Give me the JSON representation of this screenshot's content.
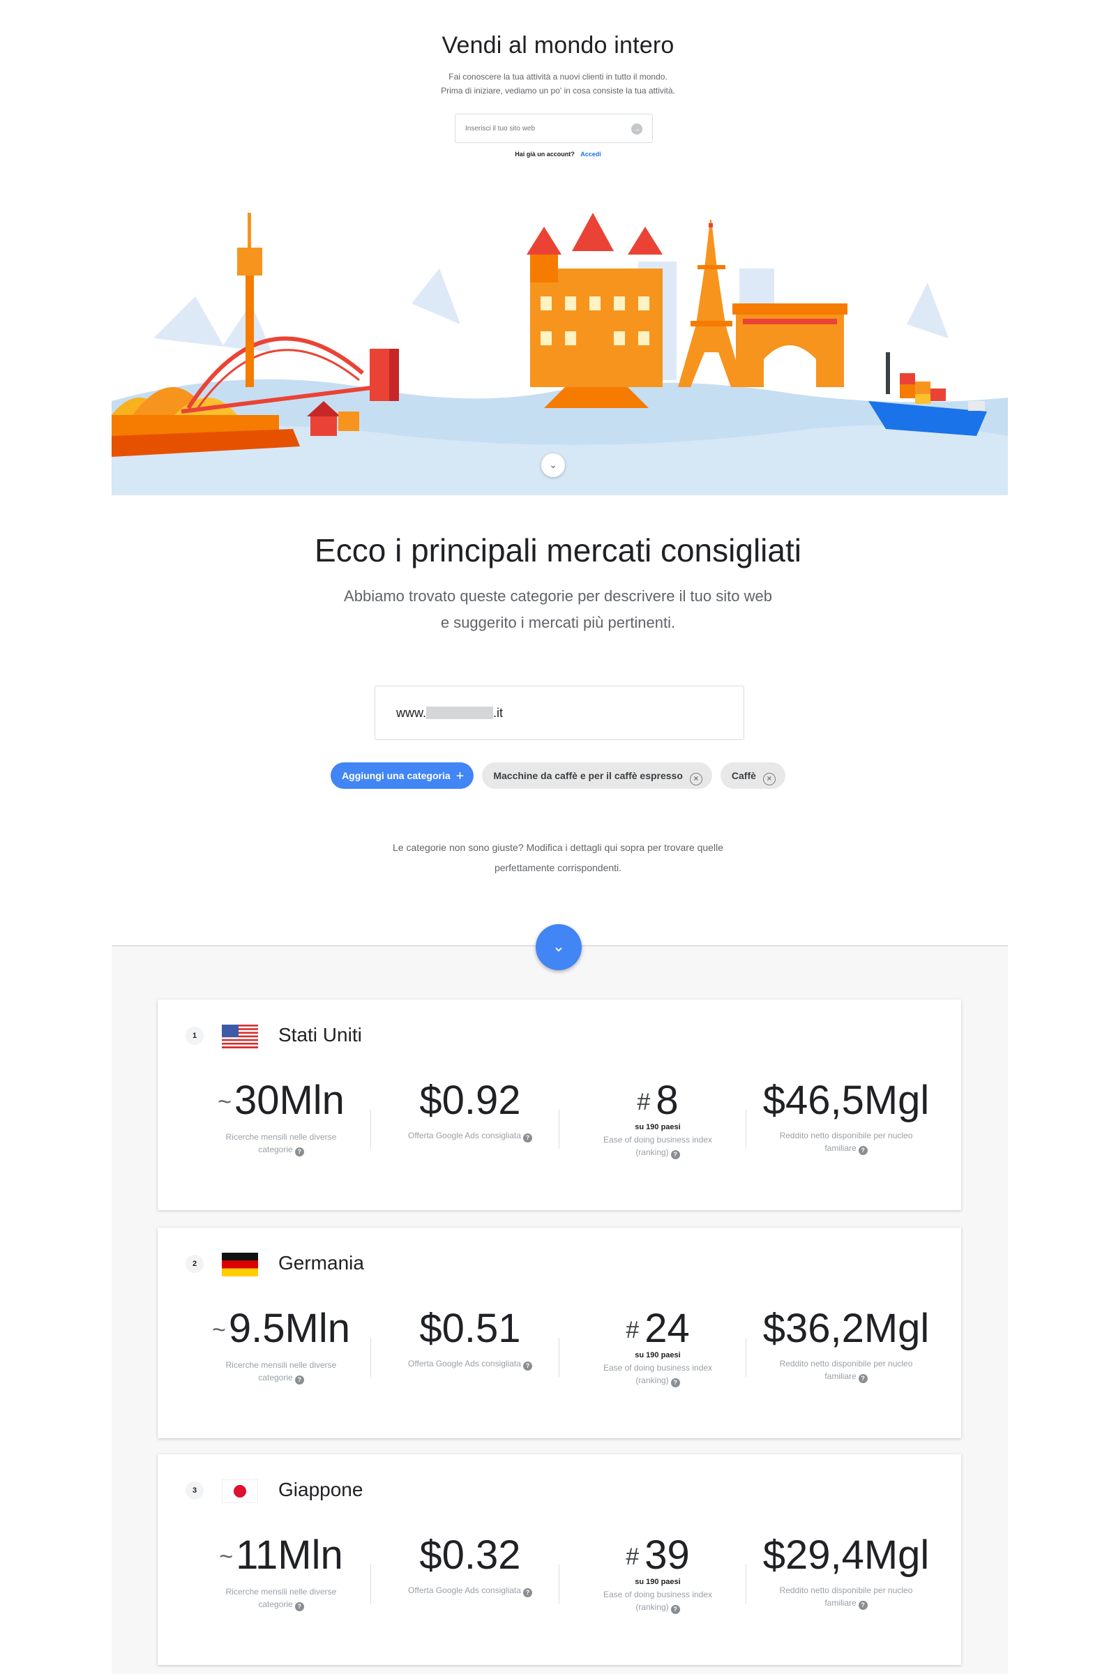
{
  "hero": {
    "title": "Vendi al mondo intero",
    "subtitle_1": "Fai conoscere la tua attività a nuovi clienti in tutto il mondo.",
    "subtitle_2": "Prima di iniziare, vediamo un po' in cosa consiste la tua attività.",
    "input_placeholder": "Inserisci il tuo sito web",
    "account_text": "Hai già un account?",
    "login_link": "Accedi"
  },
  "markets": {
    "title": "Ecco i principali mercati consigliati",
    "subtitle_1": "Abbiamo trovato queste categorie per descrivere il tuo sito web",
    "subtitle_2": "e suggerito i mercati più pertinenti.",
    "site_prefix": "www.",
    "site_suffix": ".it",
    "add_category_label": "Aggiungi una categoria",
    "categories": [
      "Macchine da caffè e per il caffè espresso",
      "Caffè"
    ],
    "hint_1": "Le categorie non sono giuste? Modifica i dettagli qui sopra per trovare quelle",
    "hint_2": "perfettamente corrispondenti."
  },
  "labels": {
    "searches_1": "Ricerche mensili nelle diverse",
    "searches_2": "categorie",
    "bid": "Offerta Google Ads consigliata",
    "ease_of": "su 190 paesi",
    "ease_1": "Ease of doing business index",
    "ease_2": "(ranking)",
    "income_1": "Reddito netto disponibile per nucleo",
    "income_2": "familiare"
  },
  "results": [
    {
      "rank": "1",
      "country": "Stati Uniti",
      "flag": "us-flag",
      "searches": "30Mln",
      "bid": "$0.92",
      "ease": "8",
      "income": "$46,5Mgl"
    },
    {
      "rank": "2",
      "country": "Germania",
      "flag": "de-flag",
      "searches": "9.5Mln",
      "bid": "$0.51",
      "ease": "24",
      "income": "$36,2Mgl"
    },
    {
      "rank": "3",
      "country": "Giappone",
      "flag": "jp-flag",
      "searches": "11Mln",
      "bid": "$0.32",
      "ease": "39",
      "income": "$29,4Mgl"
    }
  ],
  "colors": {
    "accent_blue": "#4285f4",
    "link_blue": "#1a73e8",
    "water": "#c6def2",
    "orange": "#f7941d",
    "red": "#ea4335"
  }
}
